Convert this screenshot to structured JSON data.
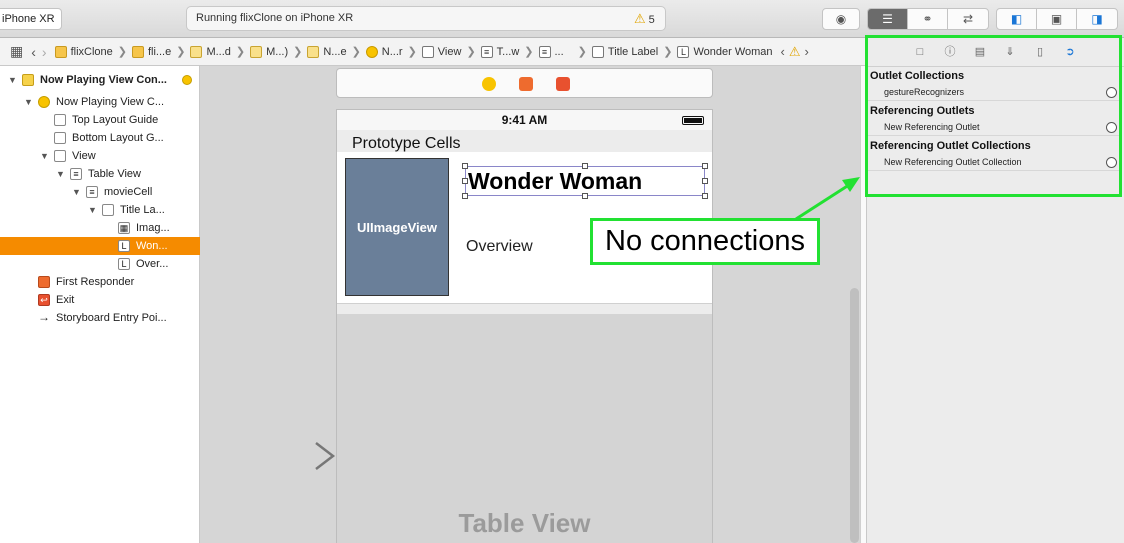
{
  "toolbar": {
    "scheme_device": "iPhone XR",
    "activity_text": "Running flixClone on iPhone XR",
    "warning_count": "5"
  },
  "jumpbar": {
    "crumbs": [
      "flixClone",
      "fli...e",
      "M...d",
      "M...)",
      "N...e",
      "N...r",
      "View",
      "T...w",
      "...",
      "Title Label",
      "Wonder Woman"
    ]
  },
  "outline": {
    "items": [
      {
        "label": "Now Playing View Con...",
        "bold": true
      },
      {
        "label": "Now Playing View C..."
      },
      {
        "label": "Top Layout Guide"
      },
      {
        "label": "Bottom Layout G..."
      },
      {
        "label": "View"
      },
      {
        "label": "Table View"
      },
      {
        "label": "movieCell"
      },
      {
        "label": "Title La..."
      },
      {
        "label": "Imag..."
      },
      {
        "label": "Won..."
      },
      {
        "label": "Over..."
      },
      {
        "label": "First Responder"
      },
      {
        "label": "Exit"
      },
      {
        "label": "Storyboard Entry Poi..."
      }
    ]
  },
  "canvas": {
    "status_time": "9:41 AM",
    "prototype_cells": "Prototype Cells",
    "image_view": "UIImageView",
    "title_label": "Wonder Woman",
    "overview_label": "Overview",
    "table_view_label": "Table View"
  },
  "callout": {
    "text": "No connections",
    "color": "#22e132"
  },
  "inspector": {
    "sections": [
      {
        "title": "Outlet Collections",
        "items": [
          "gestureRecognizers"
        ]
      },
      {
        "title": "Referencing Outlets",
        "items": [
          "New Referencing Outlet"
        ]
      },
      {
        "title": "Referencing Outlet Collections",
        "items": [
          "New Referencing Outlet Collection"
        ]
      }
    ]
  },
  "colors": {
    "selection": "#f58b00",
    "image_view_bg": "#6a7f99",
    "inspector_accent": "#1a76d6"
  }
}
